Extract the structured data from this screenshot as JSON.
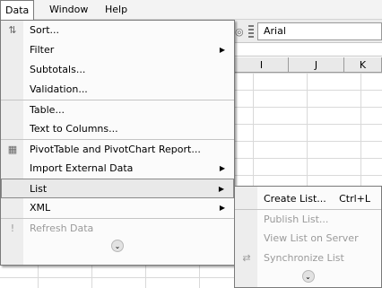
{
  "menubar": {
    "items": [
      "Data",
      "Window",
      "Help"
    ]
  },
  "toolbar": {
    "font_name": "Arial"
  },
  "columns": [
    "I",
    "J",
    "K"
  ],
  "data_menu": {
    "items": [
      {
        "label": "Sort...",
        "icon": "sort-ascending-icon"
      },
      {
        "label": "Filter"
      },
      {
        "label": "Subtotals..."
      },
      {
        "label": "Validation..."
      },
      {
        "label": "Table..."
      },
      {
        "label": "Text to Columns..."
      },
      {
        "label": "PivotTable and PivotChart Report...",
        "icon": "pivot-table-icon"
      },
      {
        "label": "Import External Data"
      },
      {
        "label": "List"
      },
      {
        "label": "XML"
      },
      {
        "label": "Refresh Data",
        "icon": "refresh-icon"
      }
    ]
  },
  "list_submenu": {
    "items": [
      {
        "label": "Create List...",
        "shortcut": "Ctrl+L"
      },
      {
        "label": "Publish List..."
      },
      {
        "label": "View List on Server"
      },
      {
        "label": "Synchronize List",
        "icon": "sync-icon"
      }
    ]
  }
}
